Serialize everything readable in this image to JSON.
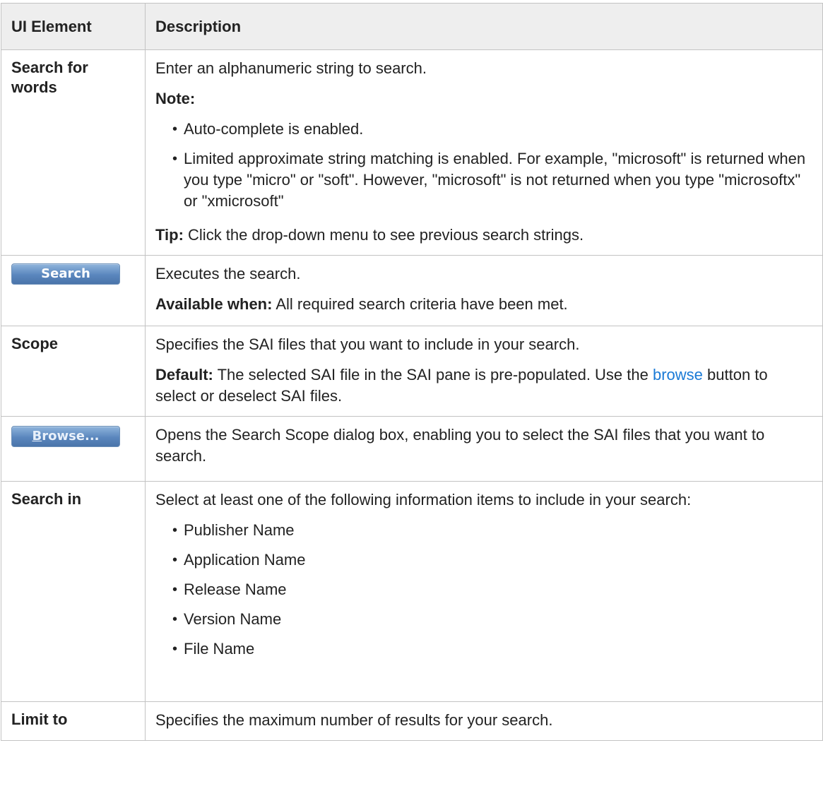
{
  "header": {
    "col1": "UI Element",
    "col2": "Description"
  },
  "rows": {
    "search_words": {
      "element": "Search for words",
      "desc": "Enter an alphanumeric string to search.",
      "note_label": "Note:",
      "bullets": [
        "Auto-complete is enabled.",
        "Limited approximate string matching is enabled. For example, \"microsoft\" is returned when you type \"micro\" or \"soft\". However, \"microsoft\" is not returned when you type \"microsoftx\" or \"xmicrosoft\""
      ],
      "tip_label": "Tip:",
      "tip_text": " Click the drop-down menu to see previous search strings."
    },
    "search_btn": {
      "button_label": "Search",
      "desc": "Executes the search.",
      "avail_label": "Available when:",
      "avail_text": "  All required search criteria have been met."
    },
    "scope": {
      "element": "Scope",
      "desc": "Specifies the SAI files that you want to include in your search.",
      "default_label": "Default:",
      "default_text": " The selected SAI file in the SAI pane is pre-populated. Use the ",
      "link_text": "browse",
      "default_text2": " button to select or deselect SAI files."
    },
    "browse_btn": {
      "button_first": "B",
      "button_rest": "rowse...",
      "desc": "Opens the Search Scope dialog box, enabling you to select the SAI files that you want to search."
    },
    "search_in": {
      "element": "Search in",
      "desc": "Select at least one of the following information items to include in your search:",
      "items": [
        "Publisher Name",
        "Application Name",
        "Release Name",
        "Version Name",
        "File Name"
      ]
    },
    "limit": {
      "element": "Limit to",
      "desc": "Specifies the maximum number of results for your search."
    }
  },
  "colors": {
    "link": "#1a7ad6",
    "header_bg": "#eeeeee",
    "border": "#c3c3c3",
    "button": "#5a86bd"
  }
}
